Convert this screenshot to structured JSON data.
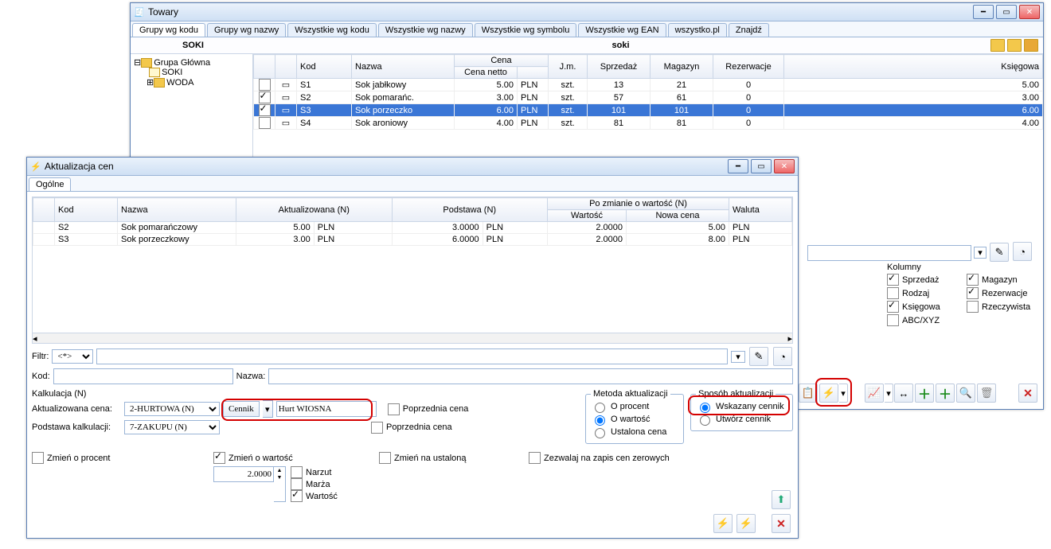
{
  "towary": {
    "title": "Towary",
    "tabs": [
      "Grupy wg kodu",
      "Grupy wg nazwy",
      "Wszystkie wg kodu",
      "Wszystkie wg nazwy",
      "Wszystkie wg symbolu",
      "Wszystkie wg EAN",
      "wszystko.pl",
      "Znajdź"
    ],
    "group_code": "SOKI",
    "group_name": "soki",
    "tree": {
      "root": "Grupa Główna",
      "children": [
        "SOKI",
        "WODA"
      ]
    },
    "cols": {
      "kod": "Kod",
      "nazwa": "Nazwa",
      "cena": "Cena",
      "cena_sub": "Cena netto",
      "jm": "J.m.",
      "sprzedaz": "Sprzedaż",
      "magazyn": "Magazyn",
      "rezerwacje": "Rezerwacje",
      "ksiegowa": "Księgowa"
    },
    "rows": [
      {
        "chk": false,
        "kod": "S1",
        "nazwa": "Sok jabłkowy",
        "cena": "5.00",
        "wal": "PLN",
        "jm": "szt.",
        "sp": "13",
        "mg": "21",
        "rz": "0",
        "ks": "5.00",
        "sel": false
      },
      {
        "chk": true,
        "kod": "S2",
        "nazwa": "Sok pomarańc.",
        "cena": "3.00",
        "wal": "PLN",
        "jm": "szt.",
        "sp": "57",
        "mg": "61",
        "rz": "0",
        "ks": "3.00",
        "sel": false
      },
      {
        "chk": true,
        "kod": "S3",
        "nazwa": "Sok porzeczko",
        "cena": "6.00",
        "wal": "PLN",
        "jm": "szt.",
        "sp": "101",
        "mg": "101",
        "rz": "0",
        "ks": "6.00",
        "sel": true
      },
      {
        "chk": false,
        "kod": "S4",
        "nazwa": "Sok aroniowy",
        "cena": "4.00",
        "wal": "PLN",
        "jm": "szt.",
        "sp": "81",
        "mg": "81",
        "rz": "0",
        "ks": "4.00",
        "sel": false
      }
    ],
    "kolumny": {
      "title": "Kolumny",
      "items": [
        {
          "label": "Sprzedaż",
          "chk": true
        },
        {
          "label": "Magazyn",
          "chk": true
        },
        {
          "label": "Rodzaj",
          "chk": false
        },
        {
          "label": "Rezerwacje",
          "chk": true
        },
        {
          "label": "Księgowa",
          "chk": true
        },
        {
          "label": "Rzeczywista",
          "chk": false
        },
        {
          "label": "ABC/XYZ",
          "chk": false
        }
      ]
    }
  },
  "akt": {
    "title": "Aktualizacja cen",
    "tab": "Ogólne",
    "cols": {
      "kod": "Kod",
      "nazwa": "Nazwa",
      "aktual": "Aktualizowana (N)",
      "podst": "Podstawa (N)",
      "pozm": "Po zmianie o wartość (N)",
      "wart": "Wartość",
      "nowa": "Nowa cena",
      "waluta": "Waluta"
    },
    "rows": [
      {
        "kod": "S2",
        "nazwa": "Sok pomarańczowy",
        "akt": "5.00",
        "aktW": "PLN",
        "pod": "3.0000",
        "podW": "PLN",
        "wart": "2.0000",
        "nowa": "5.00",
        "wal": "PLN"
      },
      {
        "kod": "S3",
        "nazwa": "Sok porzeczkowy",
        "akt": "3.00",
        "aktW": "PLN",
        "pod": "6.0000",
        "podW": "PLN",
        "wart": "2.0000",
        "nowa": "8.00",
        "wal": "PLN"
      }
    ],
    "filtr_label": "Filtr:",
    "filtr_val": "<*>",
    "kod_label": "Kod:",
    "nazwa_label": "Nazwa:",
    "kalk": {
      "legend": "Kalkulacja (N)",
      "akt_label": "Aktualizowana cena:",
      "akt_val": "2-HURTOWA (N)",
      "cennik_btn": "Cennik",
      "cennik_val": "Hurt WIOSNA",
      "pod_label": "Podstawa kalkulacji:",
      "pod_val": "7-ZAKUPU (N)",
      "poprz1": "Poprzednia cena",
      "poprz2": "Poprzednia cena"
    },
    "metoda": {
      "legend": "Metoda aktualizacji",
      "o1": "O procent",
      "o2": "O wartość",
      "o3": "Ustalona cena"
    },
    "sposob": {
      "legend": "Sposób aktualizacji",
      "o1": "Wskazany cennik",
      "o2": "Utwórz cennik"
    },
    "zm_proc": "Zmień o procent",
    "zm_wart": "Zmień o wartość",
    "zm_wart_val": "2.0000",
    "narzut": "Narzut",
    "marza": "Marża",
    "wartosc": "Wartość",
    "zm_ust": "Zmień na ustaloną",
    "zezw": "Zezwalaj na zapis cen zerowych"
  }
}
